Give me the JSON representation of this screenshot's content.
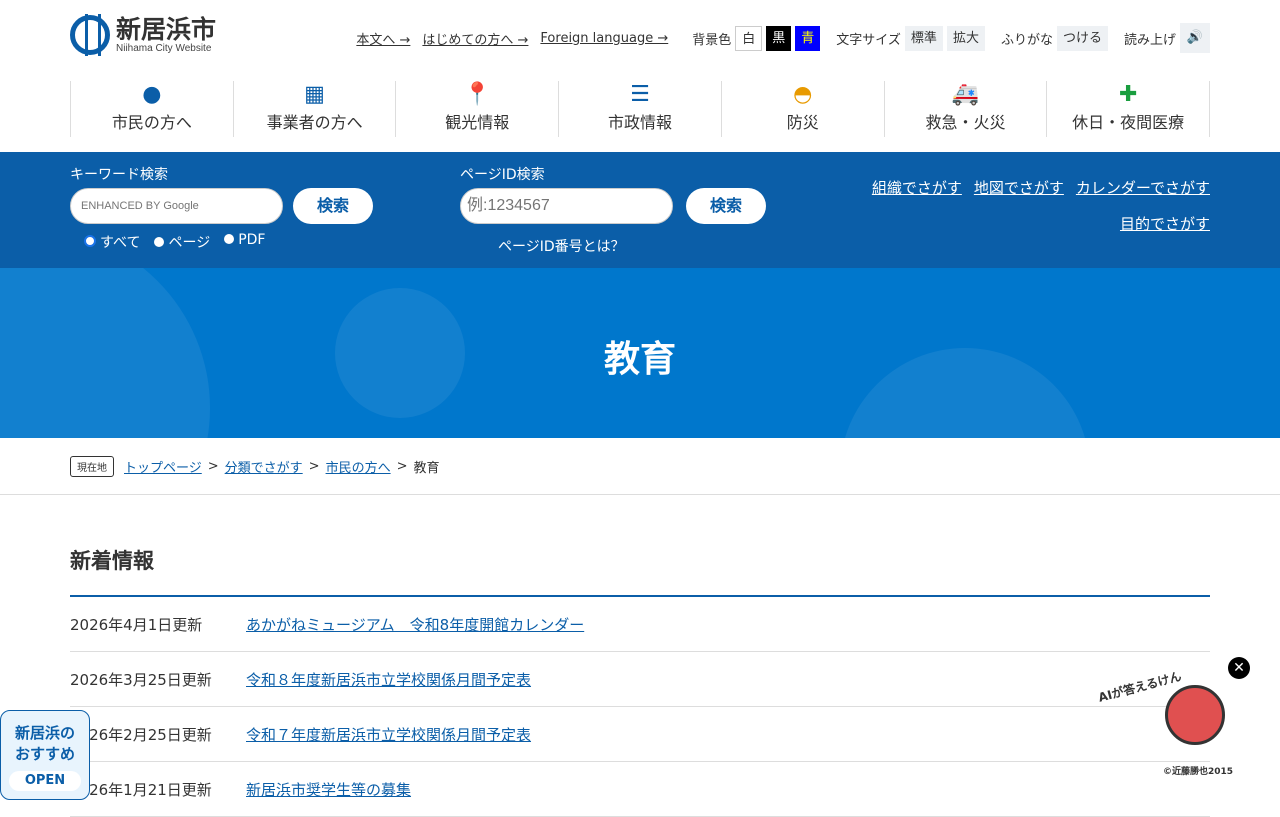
{
  "logo": {
    "name": "新居浜市",
    "sub": "Niihama City Website"
  },
  "util": {
    "links": [
      "本文へ →",
      "はじめての方へ →",
      "Foreign language →"
    ],
    "bg_label": "背景色",
    "bg": [
      "白",
      "黒",
      "青"
    ],
    "size_label": "文字サイズ",
    "sizes": [
      "標準",
      "拡大"
    ],
    "furigana_label": "ふりがな",
    "furigana": "つける",
    "read_label": "読み上げ"
  },
  "nav": [
    {
      "label": "市民の方へ",
      "icon": "person-icon"
    },
    {
      "label": "事業者の方へ",
      "icon": "building-icon"
    },
    {
      "label": "観光情報",
      "icon": "map-pin-icon"
    },
    {
      "label": "市政情報",
      "icon": "list-icon"
    },
    {
      "label": "防災",
      "icon": "helmet-icon"
    },
    {
      "label": "救急・火災",
      "icon": "ambulance-icon"
    },
    {
      "label": "休日・夜間医療",
      "icon": "medical-kit-icon"
    }
  ],
  "search": {
    "keyword_label": "キーワード検索",
    "google_placeholder": "ENHANCED BY Google",
    "button": "検索",
    "radios": [
      "すべて",
      "ページ",
      "PDF"
    ],
    "pageid_label": "ページID検索",
    "pageid_placeholder": "例:1234567",
    "pageid_help": "ページID番号とは？",
    "links": [
      "組織でさがす",
      "地図でさがす",
      "カレンダーでさがす",
      "目的でさがす"
    ]
  },
  "hero": {
    "title": "教育"
  },
  "breadcrumb": {
    "current_label": "現在地",
    "items": [
      "トップページ",
      "分類でさがす",
      "市民の方へ"
    ],
    "current": "教育"
  },
  "news": {
    "title": "新着情報",
    "items": [
      {
        "date": "2026年4月1日更新",
        "title": "あかがねミュージアム　令和8年度開館カレンダー"
      },
      {
        "date": "2026年3月25日更新",
        "title": "令和８年度新居浜市立学校関係月間予定表"
      },
      {
        "date": "2026年2月25日更新",
        "title": "令和７年度新居浜市立学校関係月間予定表"
      },
      {
        "date": "2026年1月21日更新",
        "title": "新居浜市奨学生等の募集"
      }
    ]
  },
  "recommend": {
    "label1": "新居浜の",
    "label2": "おすすめ",
    "open": "OPEN"
  },
  "ai": {
    "label": "AIが答えるけん",
    "copyright": "©近藤勝也2015"
  },
  "colors": {
    "primary": "#0b5ea8",
    "hero": "#0077cc"
  }
}
